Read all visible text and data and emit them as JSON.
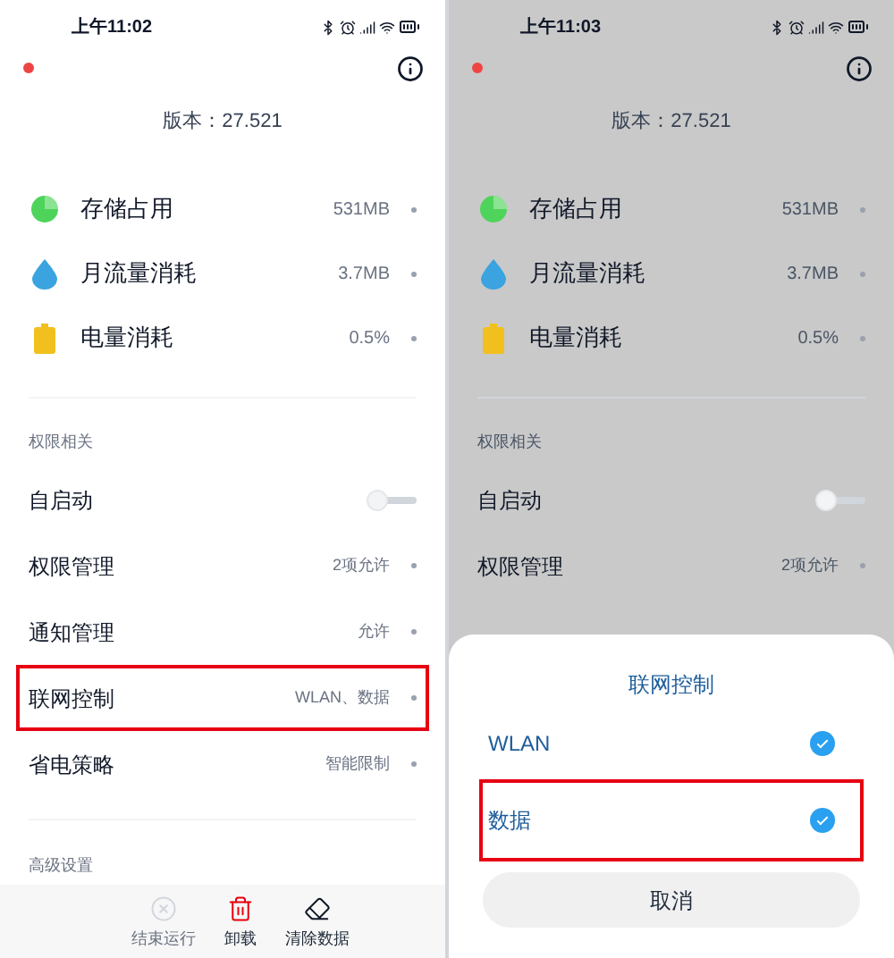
{
  "panels": [
    {
      "dimmed": false,
      "status_bar": {
        "time": "上午11:02"
      },
      "version": "版本：27.521",
      "usage": [
        {
          "kind": "storage",
          "label": "存储占用",
          "value": "531MB"
        },
        {
          "kind": "traffic",
          "label": "月流量消耗",
          "value": "3.7MB"
        },
        {
          "kind": "battery",
          "label": "电量消耗",
          "value": "0.5%"
        }
      ],
      "permissions": {
        "header": "权限相关",
        "rows": [
          {
            "kind": "toggle",
            "label": "自启动",
            "on": false,
            "highlighted": false
          },
          {
            "kind": "link",
            "label": "权限管理",
            "value": "2项允许",
            "highlighted": false
          },
          {
            "kind": "link",
            "label": "通知管理",
            "value": "允许",
            "highlighted": false
          },
          {
            "kind": "link",
            "label": "联网控制",
            "value": "WLAN、数据",
            "highlighted": true
          },
          {
            "kind": "link",
            "label": "省电策略",
            "value": "智能限制",
            "highlighted": false
          }
        ]
      },
      "advanced": {
        "header": "高级设置"
      },
      "actions": [
        {
          "kind": "stop",
          "label": "结束运行",
          "disabled": true
        },
        {
          "kind": "uninstall",
          "label": "卸载",
          "disabled": false
        },
        {
          "kind": "clear",
          "label": "清除数据",
          "disabled": false
        }
      ]
    },
    {
      "dimmed": true,
      "status_bar": {
        "time": "上午11:03"
      },
      "version": "版本：27.521",
      "usage": [
        {
          "kind": "storage",
          "label": "存储占用",
          "value": "531MB"
        },
        {
          "kind": "traffic",
          "label": "月流量消耗",
          "value": "3.7MB"
        },
        {
          "kind": "battery",
          "label": "电量消耗",
          "value": "0.5%"
        }
      ],
      "permissions": {
        "header": "权限相关",
        "rows": [
          {
            "kind": "toggle",
            "label": "自启动",
            "on": false,
            "highlighted": false
          },
          {
            "kind": "link",
            "label": "权限管理",
            "value": "2项允许",
            "highlighted": false
          }
        ]
      },
      "dialog": {
        "title": "联网控制",
        "options": [
          {
            "label": "WLAN",
            "checked": true,
            "highlighted": false
          },
          {
            "label": "数据",
            "checked": true,
            "highlighted": true
          }
        ],
        "cancel": "取消"
      }
    }
  ]
}
